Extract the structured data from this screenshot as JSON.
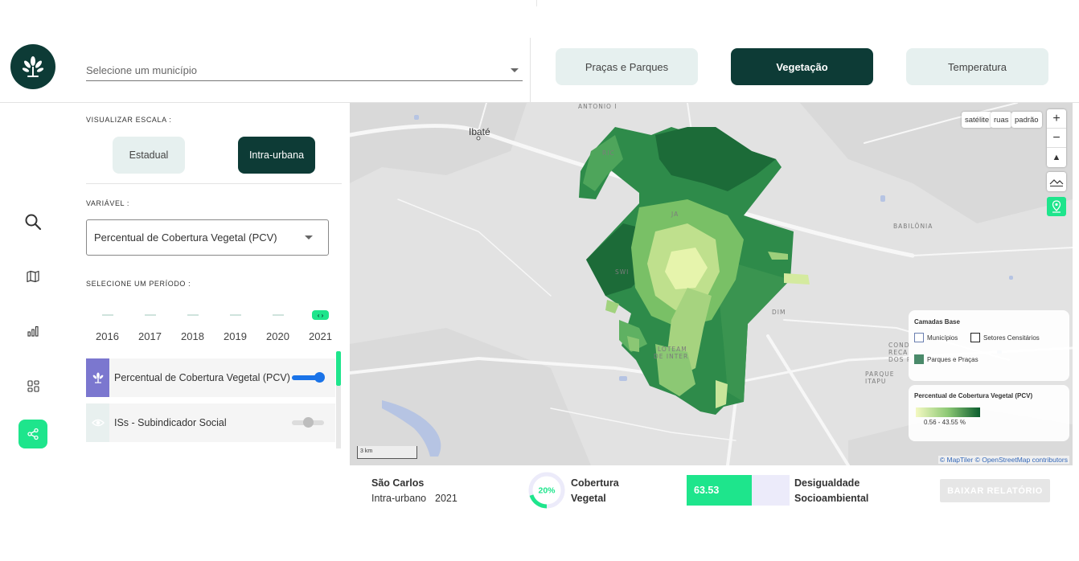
{
  "header": {
    "municipality_placeholder": "Selecione um município",
    "tabs": [
      {
        "label": "Praças e Parques",
        "active": false
      },
      {
        "label": "Vegetação",
        "active": true
      },
      {
        "label": "Temperatura",
        "active": false
      }
    ]
  },
  "rail": {
    "icons": [
      "search-icon",
      "map-icon",
      "bar-chart-icon",
      "grid-icon",
      "share-icon"
    ],
    "active": "share-icon"
  },
  "panel": {
    "scale_label": "VISUALIZAR ESCALA :",
    "scale_options": [
      "Estadual",
      "Intra-urbana"
    ],
    "scale_selected": "Intra-urbana",
    "variable_label": "VARIÁVEL :",
    "variable_value": "Percentual de Cobertura Vegetal (PCV)",
    "period_label": "SELECIONE UM PERÍODO :",
    "years": [
      "2016",
      "2017",
      "2018",
      "2019",
      "2020",
      "2021"
    ],
    "selected_year": "2021",
    "layers": [
      {
        "label": "Percentual de Cobertura Vegetal (PCV)",
        "enabled": true,
        "icon": "tree-icon"
      },
      {
        "label": "ISs - Subindicador Social",
        "enabled": false,
        "icon": "eye-icon"
      }
    ]
  },
  "map": {
    "places": {
      "antonio": "ANTONIO I",
      "ibate": "Ibaté",
      "babilonia": "BABILÔNIA",
      "parque_itapu_1": "PARQUE",
      "parque_itapu_2": "ITAPU",
      "cond_1": "COND",
      "cond_2": "RECA",
      "cond_3": "DOS P",
      "loteam": "LOTEAM",
      "inter": "DE INTER",
      "swi": "SWI",
      "aim": "DIM",
      "ja": "JA",
      "ric": "RIC"
    },
    "style_buttons": [
      "satélite",
      "ruas",
      "padrão"
    ],
    "zoom_in": "+",
    "zoom_out": "−",
    "base_layers": {
      "title": "Camadas Base",
      "items": [
        "Municípios",
        "Setores Censitários",
        "Parques e Praças"
      ]
    },
    "legend": {
      "title": "Percentual de Cobertura Vegetal (PCV)",
      "range": "0.56 - 43.55 %",
      "color_low": "#f4f9c2",
      "color_high": "#0b5d2e"
    },
    "scale": "3 km",
    "attribution": "© MapTiler © OpenStreetMap contributors"
  },
  "footer": {
    "city": "São Carlos",
    "scope": "Intra-urbano",
    "year": "2021",
    "coverage_percent": "20%",
    "coverage_fraction": 0.2,
    "coverage_label_1": "Cobertura",
    "coverage_label_2": "Vegetal",
    "inequality_value": "63.53",
    "inequality_fraction": 0.6353,
    "inequality_label_1": "Desigualdade",
    "inequality_label_2": "Socioambiental",
    "report_button": "BAIXAR RELATÓRIO"
  },
  "colors": {
    "brand_dark": "#0d3b36",
    "accent_green": "#1ee58c",
    "layer_active_icon_bg": "#7b77cf"
  }
}
